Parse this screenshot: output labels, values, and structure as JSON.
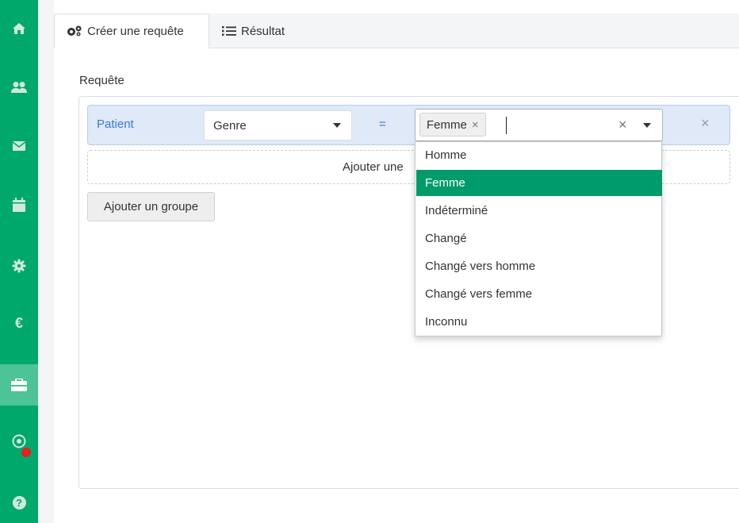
{
  "sidebar": {
    "items": [
      {
        "icon": "home-icon"
      },
      {
        "icon": "users-icon"
      },
      {
        "icon": "envelope-icon"
      },
      {
        "icon": "calendar-icon"
      },
      {
        "icon": "gear-icon"
      },
      {
        "icon": "euro-icon",
        "glyph": "€"
      },
      {
        "icon": "toolbox-icon",
        "active": true
      },
      {
        "icon": "radar-icon"
      },
      {
        "icon": "help-icon",
        "glyph": "?"
      }
    ],
    "colors": {
      "background": "#00a86b",
      "active": "#4cc495",
      "notification": "#e8201a"
    }
  },
  "tabs": [
    {
      "label": "Créer une requête",
      "icon": "cogs-icon",
      "active": true
    },
    {
      "label": "Résultat",
      "icon": "list-icon",
      "active": false
    }
  ],
  "query": {
    "section_label": "Requête",
    "rule": {
      "entity": "Patient",
      "field": "Genre",
      "operator": "=",
      "selected_values": [
        "Femme"
      ],
      "chip_remove": "×",
      "clear_all": "×",
      "remove_rule": "×"
    },
    "add_rule_label": "Ajouter une",
    "add_group_label": "Ajouter un groupe"
  },
  "dropdown": {
    "options": [
      "Homme",
      "Femme",
      "Indéterminé",
      "Changé",
      "Changé vers homme",
      "Changé vers femme",
      "Inconnu"
    ],
    "highlighted": "Femme",
    "highlight_color": "#009b6a"
  }
}
